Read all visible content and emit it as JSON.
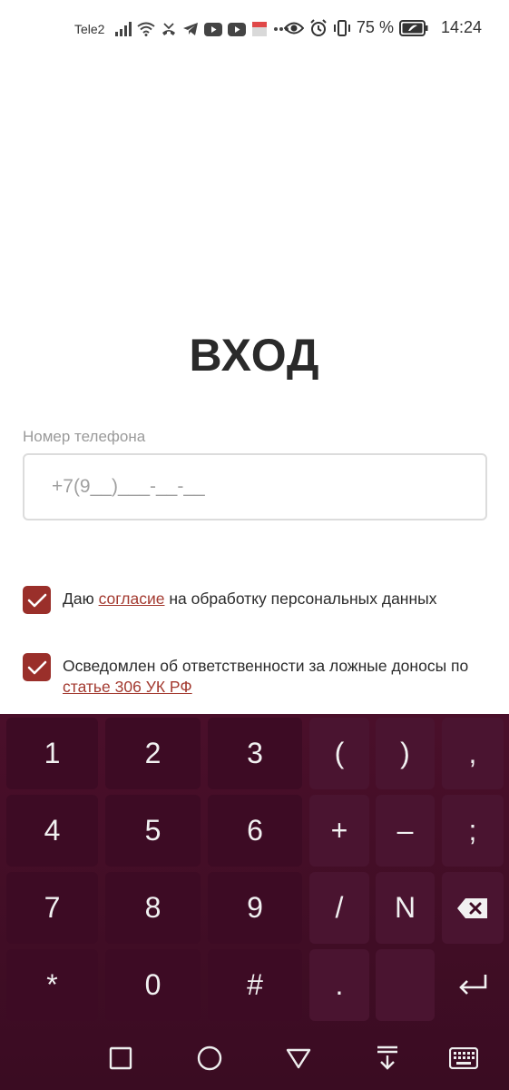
{
  "status_bar": {
    "carrier": "Tele2",
    "battery_percent": "75 %",
    "time": "14:24",
    "icons": [
      "signal-icon",
      "wifi-icon",
      "missed-call-icon",
      "telegram-icon",
      "youtube-icon",
      "youtube-icon",
      "notification-icon",
      "more-icon",
      "eye-icon",
      "alarm-icon",
      "vibrate-icon",
      "battery-icon"
    ]
  },
  "login": {
    "title": "ВХОД",
    "phone_label": "Номер телефона",
    "phone_placeholder": "+7(9__)___-__-__"
  },
  "consents": [
    {
      "checked": true,
      "text_before": "Даю ",
      "link_text": "согласие",
      "text_after": " на обработку персональных данных"
    },
    {
      "checked": true,
      "text_before": "Осведомлен об ответственности за ложные доносы по ",
      "link_text": "статье 306 УК РФ",
      "text_after": ""
    }
  ],
  "keyboard": {
    "rows": [
      [
        "1",
        "2",
        "3",
        "(",
        ")",
        ","
      ],
      [
        "4",
        "5",
        "6",
        "+",
        "–",
        ";"
      ],
      [
        "7",
        "8",
        "9",
        "/",
        "N",
        "backspace-icon"
      ],
      [
        "*",
        "0",
        "#",
        ".",
        "",
        "enter-icon"
      ]
    ]
  },
  "colors": {
    "accent": "#9a2f2a",
    "keyboard_bg": "#3a0c22",
    "key_bg": "#3d0b24"
  }
}
